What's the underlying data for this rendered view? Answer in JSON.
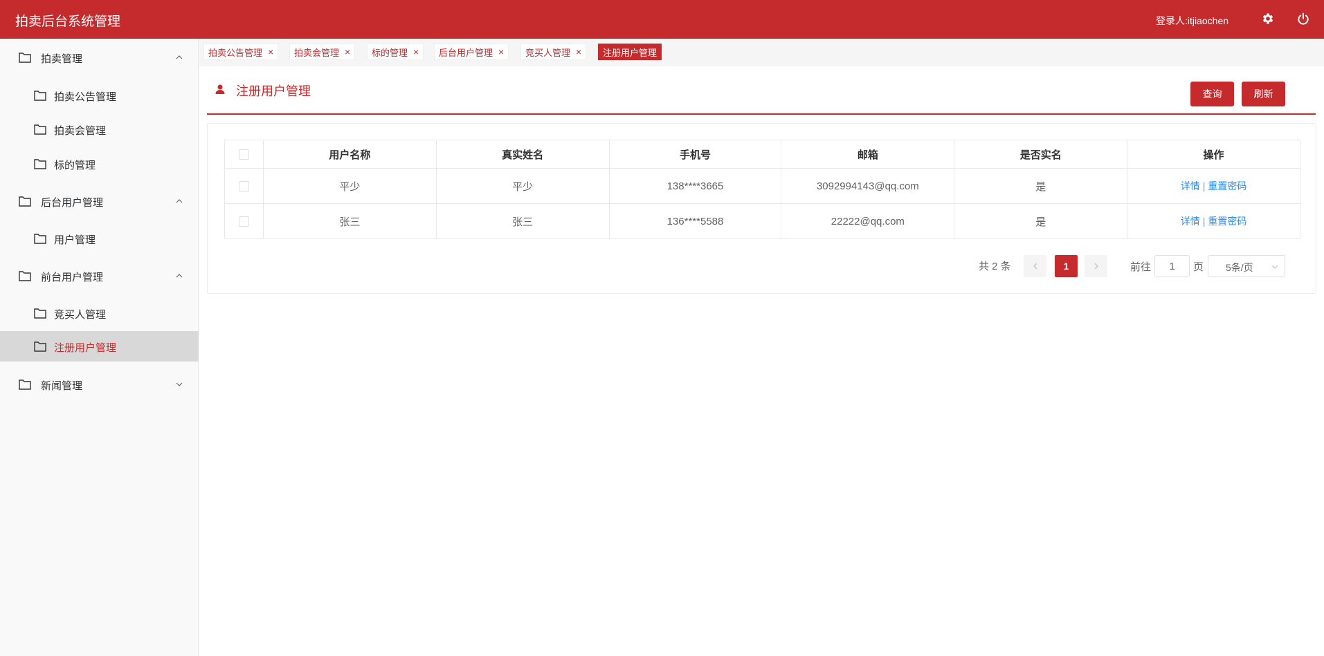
{
  "header": {
    "title": "拍卖后台系统管理",
    "login_user": "登录人:itjiaochen",
    "settings_icon": "gear-icon",
    "logout_icon": "power-icon"
  },
  "sidebar": {
    "items": [
      {
        "label": "拍卖管理",
        "level": 1,
        "expanded": true
      },
      {
        "label": "拍卖公告管理",
        "level": 2
      },
      {
        "label": "拍卖会管理",
        "level": 2
      },
      {
        "label": "标的管理",
        "level": 2
      },
      {
        "label": "后台用户管理",
        "level": 1,
        "expanded": true
      },
      {
        "label": "用户管理",
        "level": 2
      },
      {
        "label": "前台用户管理",
        "level": 1,
        "expanded": true
      },
      {
        "label": "竞买人管理",
        "level": 2
      },
      {
        "label": "注册用户管理",
        "level": 2,
        "active": true
      },
      {
        "label": "新闻管理",
        "level": 1,
        "expanded": false
      }
    ]
  },
  "tabs": [
    {
      "label": "拍卖公告管理"
    },
    {
      "label": "拍卖会管理"
    },
    {
      "label": "标的管理"
    },
    {
      "label": "后台用户管理"
    },
    {
      "label": "竞买人管理"
    },
    {
      "label": "注册用户管理",
      "active": true
    }
  ],
  "page": {
    "title": "注册用户管理",
    "query_label": "查询",
    "refresh_label": "刷新"
  },
  "table": {
    "columns": [
      "用户名称",
      "真实姓名",
      "手机号",
      "邮箱",
      "是否实名",
      "操作"
    ],
    "rows": [
      {
        "username": "平少",
        "real_name": "平少",
        "phone": "138****3665",
        "email": "3092994143@qq.com",
        "verified": "是"
      },
      {
        "username": "张三",
        "real_name": "张三",
        "phone": "136****5588",
        "email": "22222@qq.com",
        "verified": "是"
      }
    ],
    "actions": {
      "detail": "详情",
      "separator": "|",
      "reset_password": "重置密码"
    }
  },
  "pagination": {
    "total": "共 2 条",
    "current_page": "1",
    "goto_prefix": "前往",
    "goto_value": "1",
    "goto_suffix": "页",
    "page_size": "5条/页"
  },
  "colors": {
    "brand": "#c52a2d",
    "link": "#2d8cf0"
  }
}
